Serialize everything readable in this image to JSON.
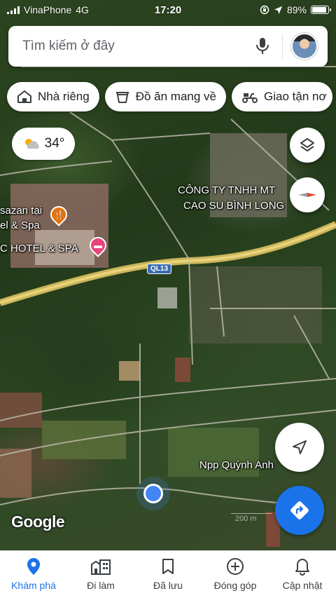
{
  "status_bar": {
    "carrier": "VinaPhone",
    "network": "4G",
    "time": "17:20",
    "battery": "89%",
    "battery_level": 0.89
  },
  "search": {
    "placeholder": "Tìm kiếm ở đây",
    "icons": {
      "mic": "mic-icon",
      "avatar": "avatar"
    }
  },
  "chips": [
    {
      "label": "Nhà riêng",
      "icon": "home-icon"
    },
    {
      "label": "Đồ ăn mang về",
      "icon": "takeout-bag-icon"
    },
    {
      "label": "Giao tận nơ",
      "icon": "delivery-scooter-icon"
    }
  ],
  "weather": {
    "temperature": "34°",
    "icon": "partly-cloudy-icon"
  },
  "map": {
    "labels": {
      "company_line1": "CÔNG TY TNHH MT",
      "company_line2": "CAO SU BÌNH LONG",
      "spa_line1": "sazan tại",
      "spa_line2": "el & Spa",
      "hotel": "C HOTEL & SPA",
      "road": "QL13",
      "store": "Npp Quỳnh Anh",
      "google": "Google",
      "scale": "200 m"
    },
    "controls": [
      "layers-icon",
      "compass-icon",
      "my-location-arrow-icon",
      "directions-icon"
    ]
  },
  "colors": {
    "accent": "#1a73e8",
    "location_dot": "#4285f4",
    "poi_food": "#e8710a",
    "poi_hotel": "#e8447a"
  },
  "bottom_nav": [
    {
      "label": "Khám phá",
      "icon": "explore-pin-icon",
      "active": true
    },
    {
      "label": "Đi làm",
      "icon": "commute-building-icon",
      "active": false
    },
    {
      "label": "Đã lưu",
      "icon": "bookmark-icon",
      "active": false
    },
    {
      "label": "Đóng góp",
      "icon": "add-circle-icon",
      "active": false
    },
    {
      "label": "Cập nhật",
      "icon": "bell-icon",
      "active": false
    }
  ]
}
